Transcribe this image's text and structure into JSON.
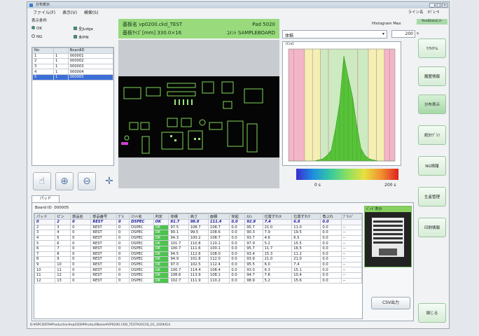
{
  "window": {
    "title": "分布表示",
    "controls": [
      "_",
      "□",
      "×"
    ]
  },
  "menu": [
    "ファイル(F)",
    "表示(V)",
    "検索(S)"
  ],
  "language": [
    "ライン名",
    "ｵﾍﾟﾚｰﾀ"
  ],
  "filter": {
    "title": "表示条件",
    "options": [
      {
        "label": "OK",
        "checked": true
      },
      {
        "label": "全Judge",
        "checked": true
      },
      {
        "label": "NG",
        "checked": false
      },
      {
        "label": "未PIN",
        "checked": true
      }
    ]
  },
  "board_list": {
    "headers": [
      "No",
      "",
      "BoardID"
    ],
    "rows": [
      [
        "1",
        "1",
        "000001"
      ],
      [
        "2",
        "1",
        "000002"
      ],
      [
        "3",
        "1",
        "000003"
      ],
      [
        "4",
        "1",
        "000004"
      ],
      [
        "5",
        "1",
        "000005"
      ]
    ]
  },
  "board_header": {
    "line1": "基板名 vp0200.ckd_TEST",
    "line2": "基板ｻｲｽﾞ[mm] 330.0×16",
    "pad_label": "Pad",
    "pad_value": "5020",
    "comment_label": "ｺﾒﾝﾄ",
    "comment_value": "SAMPLEBOARD"
  },
  "histogram": {
    "dropdown_value": "体積",
    "max_label": "Histogram Max",
    "max_value": "200",
    "max_unit": "s",
    "y_axis_label": "[Cnt]",
    "range_min": "0",
    "range_max": "200",
    "range_unit": "s"
  },
  "chart_data": {
    "type": "area",
    "x": [
      0,
      8,
      16,
      24,
      32,
      40,
      48,
      56,
      64,
      72,
      80,
      88,
      96,
      104,
      112,
      120,
      128,
      136,
      144,
      152,
      160,
      168,
      176,
      184,
      192,
      200
    ],
    "values": [
      0,
      0,
      0,
      0,
      0,
      0,
      0,
      1,
      2,
      5,
      10,
      30,
      55,
      100,
      80,
      62,
      35,
      12,
      5,
      2,
      1,
      0,
      0,
      0,
      0,
      0
    ],
    "band_edges": [
      10,
      30,
      45,
      60,
      75,
      130,
      150,
      165,
      180,
      190
    ],
    "xlim": [
      0,
      200
    ],
    "colors": {
      "fill": "#58c33a",
      "ng": "#f2b6c8",
      "warn": "#f3f0b2",
      "ok": "#cdeac0"
    }
  },
  "tools": [
    "hand-icon",
    "zoom-in-icon",
    "zoom-out-icon",
    "move-icon"
  ],
  "tab": "パッド",
  "board_id": {
    "label": "Board ID",
    "value": "000005"
  },
  "table": {
    "headers": [
      "パッド",
      "ピン",
      "部品名",
      "部品番号",
      "ｸﾞﾙ",
      "ｽﾗｯﾄ名",
      "判定",
      "体積",
      "高さ",
      "面積",
      "突起",
      "ｶｽﾚ",
      "位置ずれX",
      "位置ずれY",
      "角ぶれ",
      "ﾌﾞﾘｯｼﾞ"
    ],
    "summary": [
      "0",
      "2",
      "0",
      "REST",
      "0",
      "DSPEC",
      "OK",
      "81.7",
      "98.8",
      "111.4",
      "0.0",
      "92.8",
      "7.4",
      "6.8",
      "0.0",
      ""
    ],
    "rows": [
      [
        "2",
        "3",
        "0",
        "REST",
        "0",
        "DSPEC",
        "OK",
        "97.5",
        "108.7",
        "108.7",
        "0.0",
        "95.7",
        "21.0",
        "11.0",
        "0.0",
        "--"
      ],
      [
        "3",
        "4",
        "0",
        "REST",
        "0",
        "DSPEC",
        "OK",
        "90.1",
        "99.5",
        "108.6",
        "0.0",
        "90.3",
        "7.9",
        "19.5",
        "0.0",
        "--"
      ],
      [
        "4",
        "5",
        "0",
        "REST",
        "0",
        "DSPEC",
        "OK",
        "94.3",
        "100.2",
        "108.7",
        "0.0",
        "93.7",
        "4.6",
        "6.5",
        "0.0",
        "--"
      ],
      [
        "5",
        "6",
        "0",
        "REST",
        "0",
        "DSPEC",
        "OK",
        "101.7",
        "110.8",
        "110.1",
        "0.0",
        "97.9",
        "5.2",
        "15.5",
        "0.0",
        "--"
      ],
      [
        "6",
        "7",
        "0",
        "REST",
        "0",
        "DSPEC",
        "OK",
        "100.7",
        "111.6",
        "100.1",
        "0.0",
        "95.7",
        "11.7",
        "16.5",
        "0.0",
        "--"
      ],
      [
        "7",
        "8",
        "0",
        "REST",
        "0",
        "DSPEC",
        "OK",
        "94.5",
        "112.6",
        "108.0",
        "0.0",
        "93.4",
        "15.3",
        "11.2",
        "0.0",
        "--"
      ],
      [
        "8",
        "9",
        "0",
        "REST",
        "0",
        "DSPEC",
        "OK",
        "94.9",
        "101.8",
        "112.0",
        "0.0",
        "93.9",
        "21.0",
        "21.0",
        "0.0",
        "--"
      ],
      [
        "9",
        "10",
        "0",
        "REST",
        "0",
        "DSPEC",
        "OK",
        "97.0",
        "102.5",
        "112.4",
        "0.0",
        "95.5",
        "6.0",
        "7.4",
        "0.0",
        "--"
      ],
      [
        "10",
        "11",
        "0",
        "REST",
        "0",
        "DSPEC",
        "OK",
        "100.7",
        "114.4",
        "108.4",
        "0.0",
        "93.0",
        "6.3",
        "15.1",
        "0.0",
        "--"
      ],
      [
        "11",
        "12",
        "0",
        "REST",
        "0",
        "DSPEC",
        "OK",
        "108.6",
        "113.9",
        "108.1",
        "0.0",
        "94.7",
        "7.8",
        "10.4",
        "0.0",
        "--"
      ],
      [
        "12",
        "13",
        "0",
        "REST",
        "0",
        "DSPEC",
        "OK",
        "102.7",
        "111.9",
        "110.2",
        "0.0",
        "98.9",
        "5.2",
        "15.6",
        "0.0",
        "--"
      ]
    ]
  },
  "part_box_title": "ﾊﾟｯﾄﾞ表示",
  "csv_button": "CSV出力",
  "sidebar": {
    "top": "RealDataﾓﾆﾀｰ",
    "buttons": [
      "ﾘｱﾙﾀｲﾑ",
      "履歴情報",
      "分布表示",
      "統計ｸﾞﾗﾌ",
      "NG情報",
      "生産管理",
      "印刷情報"
    ],
    "close": "閉じる"
  },
  "status_path": "D:¥SPCDATA¥Production¥vp0200¥ProductName¥VP0200.CKD_TEST¥20150_01_1029414"
}
